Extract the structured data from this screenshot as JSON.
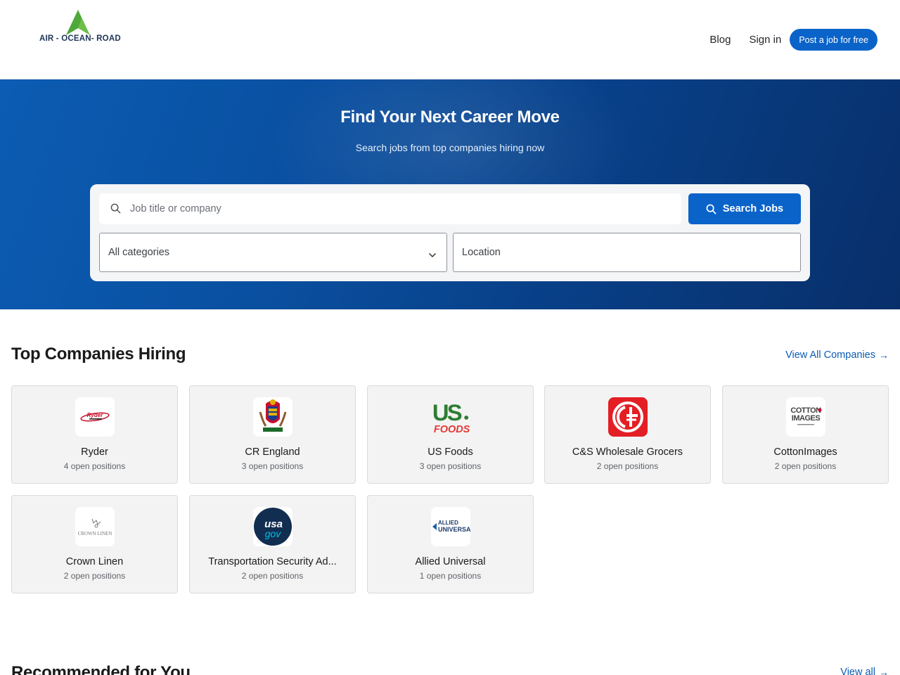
{
  "header": {
    "logo_text": "AIR - OCEAN-  ROAD",
    "nav": {
      "blog": "Blog",
      "signin": "Sign in",
      "post_job": "Post a job for free"
    }
  },
  "hero": {
    "title": "Find Your Next Career Move",
    "subtitle": "Search jobs from top companies hiring now",
    "search_placeholder": "Job title or company",
    "search_button": "Search Jobs",
    "category_selected": "All categories",
    "location_placeholder": "Location"
  },
  "companies": {
    "title": "Top Companies Hiring",
    "view_all": "View All Companies",
    "items": [
      {
        "name": "Ryder",
        "positions": "4 open positions",
        "logo": "ryder-logo"
      },
      {
        "name": "CR England",
        "positions": "3 open positions",
        "logo": "cr-england-crest"
      },
      {
        "name": "US Foods",
        "positions": "3 open positions",
        "logo": "us-foods-logo"
      },
      {
        "name": "C&S Wholesale Grocers",
        "positions": "2 open positions",
        "logo": "cs-wholesale-logo"
      },
      {
        "name": "CottonImages",
        "positions": "2 open positions",
        "logo": "cottonimages-logo"
      },
      {
        "name": "Crown Linen",
        "positions": "2 open positions",
        "logo": "crown-linen-logo"
      },
      {
        "name": "Transportation Security Ad...",
        "positions": "2 open positions",
        "logo": "usagov-logo"
      },
      {
        "name": "Allied Universal",
        "positions": "1 open positions",
        "logo": "allied-universal-logo"
      }
    ]
  },
  "recommended": {
    "title": "Recommended for You",
    "view_all": "View all"
  },
  "colors": {
    "primary": "#0a63c9",
    "hero_start": "#0b5cb3",
    "hero_end": "#082f6a",
    "link": "#0a5bb5"
  }
}
